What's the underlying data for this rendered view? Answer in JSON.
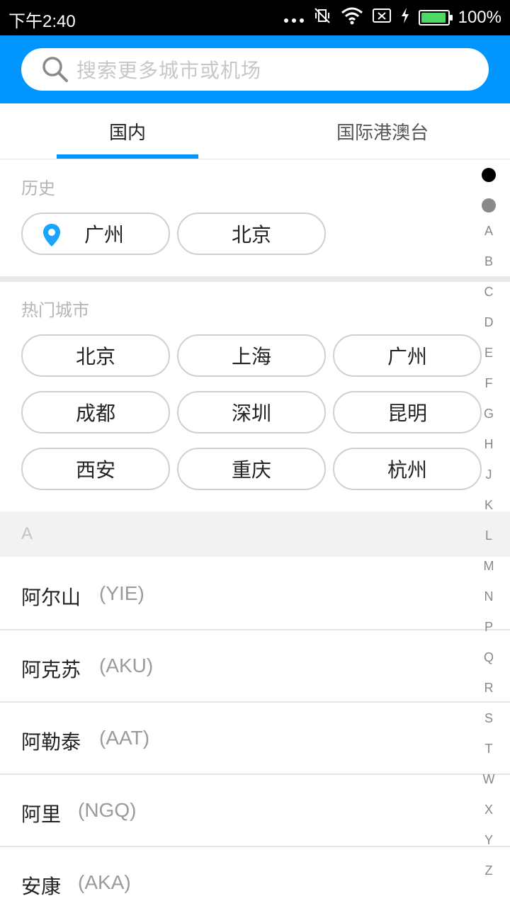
{
  "status_bar": {
    "time": "下午2:40",
    "battery": "100%"
  },
  "search": {
    "placeholder": "搜索更多城市或机场"
  },
  "tabs": [
    {
      "label": "国内",
      "active": true
    },
    {
      "label": "国际港澳台",
      "active": false
    }
  ],
  "history": {
    "title": "历史",
    "items": [
      "广州",
      "北京"
    ]
  },
  "hot": {
    "title": "热门城市",
    "items": [
      "北京",
      "上海",
      "广州",
      "成都",
      "深圳",
      "昆明",
      "西安",
      "重庆",
      "杭州"
    ]
  },
  "list": {
    "header": "A",
    "rows": [
      {
        "name": "阿尔山",
        "code": "(YIE)"
      },
      {
        "name": "阿克苏",
        "code": "(AKU)"
      },
      {
        "name": "阿勒泰",
        "code": "(AAT)"
      },
      {
        "name": "阿里",
        "code": "(NGQ)"
      },
      {
        "name": "安康",
        "code": "(AKA)"
      }
    ]
  },
  "index_letters": [
    "A",
    "B",
    "C",
    "D",
    "E",
    "F",
    "G",
    "H",
    "J",
    "K",
    "L",
    "M",
    "N",
    "P",
    "Q",
    "R",
    "S",
    "T",
    "W",
    "X",
    "Y",
    "Z"
  ],
  "colors": {
    "primary": "#0095ff",
    "pin": "#1aa3ff"
  }
}
